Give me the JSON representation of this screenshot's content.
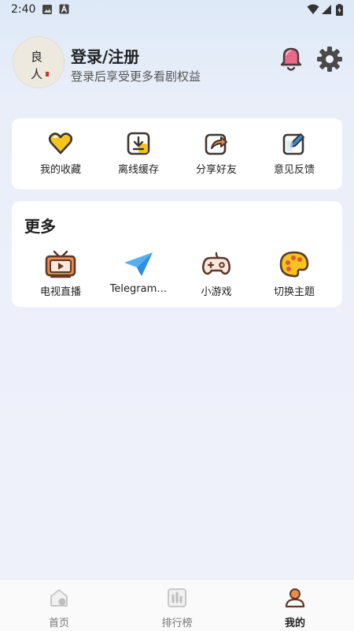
{
  "status_bar": {
    "time": "2:40"
  },
  "profile": {
    "title": "登录/注册",
    "subtitle": "登录后享受更多看剧权益",
    "avatar_text": "良人"
  },
  "quick_actions": [
    {
      "label": "我的收藏",
      "icon": "heart-icon"
    },
    {
      "label": "离线缓存",
      "icon": "download-icon"
    },
    {
      "label": "分享好友",
      "icon": "share-icon"
    },
    {
      "label": "意见反馈",
      "icon": "feedback-edit-icon"
    }
  ],
  "more": {
    "title": "更多",
    "items": [
      {
        "label": "电视直播",
        "icon": "tv-icon"
      },
      {
        "label": "Telegram…",
        "icon": "telegram-icon"
      },
      {
        "label": "小游戏",
        "icon": "gamepad-icon"
      },
      {
        "label": "切换主题",
        "icon": "palette-icon"
      }
    ]
  },
  "tabs": [
    {
      "label": "首页",
      "icon": "home-icon",
      "active": false
    },
    {
      "label": "排行榜",
      "icon": "chart-icon",
      "active": false
    },
    {
      "label": "我的",
      "icon": "profile-icon",
      "active": true
    }
  ],
  "colors": {
    "accent_yellow": "#f5c51c",
    "accent_orange": "#f08a4b",
    "accent_blue": "#2d8fe0",
    "brown_outline": "#5b3a29"
  }
}
